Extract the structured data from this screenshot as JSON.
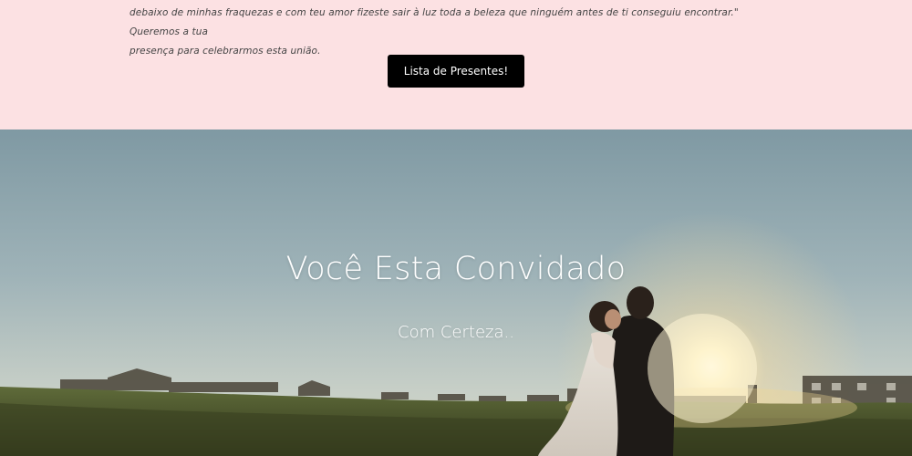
{
  "intro": {
    "paragraph_line1": "debaixo de minhas fraquezas e com teu amor fizeste sair à luz toda a beleza que ninguém antes de ti conseguiu encontrar.\" Queremos a tua",
    "paragraph_line2": "presença para celebrarmos esta união."
  },
  "gift_button": {
    "label": "Lista de Presentes!"
  },
  "hero": {
    "title": "Você Esta Convidado",
    "subtitle": "Com Certeza..",
    "image_subject": "couple-at-sunset-photo"
  },
  "colors": {
    "intro_background": "#fce1e3",
    "button_background": "#000000",
    "button_text": "#ffffff",
    "hero_text": "#ffffff"
  }
}
